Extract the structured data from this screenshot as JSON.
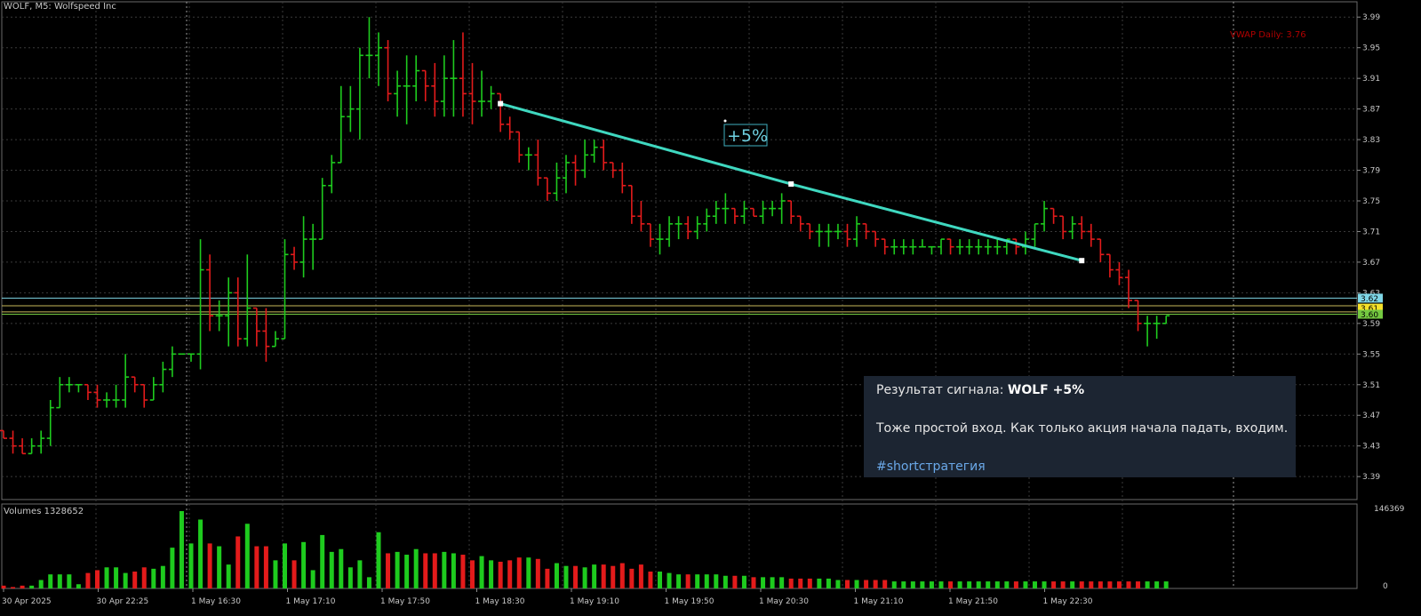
{
  "chart_title": "WOLF, M5:  Wolfspeed Inc",
  "volume_title": "Volumes 1328652",
  "vwap_label": "VWAP Daily: 3.76",
  "volume_axis": {
    "max_label": "146369",
    "zero_label": "0"
  },
  "annotation_label": "+5%",
  "colors": {
    "up": "#1ecb1e",
    "down": "#e31b1b",
    "grid": "#3a3a3a",
    "trend": "#3fd8c0",
    "level_cyan": "#7fd6e6",
    "level_yellow": "#f5e12a",
    "level_olive": "#c8b85a",
    "level_green": "#74c840"
  },
  "message": {
    "prefix": "Результат сигнала: ",
    "highlight": "WOLF +5%",
    "body": "Тоже простой вход. Как только акция начала падать, входим.",
    "hashtag": "#shortстратегия"
  },
  "chart_data": {
    "type": "candlestick",
    "y_ticks": [
      "3.99",
      "3.95",
      "3.91",
      "3.87",
      "3.83",
      "3.79",
      "3.75",
      "3.71",
      "3.67",
      "3.63",
      "3.59",
      "3.55",
      "3.51",
      "3.47",
      "3.43",
      "3.39"
    ],
    "ylim": [
      3.36,
      4.01
    ],
    "price_labels": [
      {
        "text": "3.62",
        "value": 3.623,
        "color": "#7fd6e6"
      },
      {
        "text": "3.61",
        "value": 3.61,
        "color": "#f5e12a"
      },
      {
        "text": "3.60",
        "value": 3.602,
        "color": "#74c840"
      }
    ],
    "x_labels": [
      "30 Apr 2025",
      "30 Apr 22:25",
      "1 May 16:30",
      "1 May 17:10",
      "1 May 17:50",
      "1 May 18:30",
      "1 May 19:10",
      "1 May 19:50",
      "1 May 20:30",
      "1 May 21:10",
      "1 May 21:50",
      "1 May 22:30"
    ],
    "candles": [
      [
        3.45,
        3.45,
        3.44,
        3.44
      ],
      [
        3.44,
        3.45,
        3.42,
        3.43
      ],
      [
        3.43,
        3.44,
        3.42,
        3.42
      ],
      [
        3.42,
        3.44,
        3.42,
        3.43
      ],
      [
        3.43,
        3.45,
        3.42,
        3.44
      ],
      [
        3.44,
        3.49,
        3.43,
        3.48
      ],
      [
        3.48,
        3.52,
        3.48,
        3.51
      ],
      [
        3.51,
        3.52,
        3.5,
        3.51
      ],
      [
        3.51,
        3.51,
        3.5,
        3.51
      ],
      [
        3.51,
        3.51,
        3.49,
        3.5
      ],
      [
        3.5,
        3.51,
        3.48,
        3.49
      ],
      [
        3.49,
        3.5,
        3.48,
        3.49
      ],
      [
        3.49,
        3.51,
        3.48,
        3.49
      ],
      [
        3.49,
        3.55,
        3.48,
        3.52
      ],
      [
        3.52,
        3.52,
        3.5,
        3.51
      ],
      [
        3.51,
        3.51,
        3.48,
        3.49
      ],
      [
        3.49,
        3.52,
        3.49,
        3.51
      ],
      [
        3.51,
        3.54,
        3.5,
        3.53
      ],
      [
        3.53,
        3.56,
        3.52,
        3.55
      ],
      [
        3.55,
        3.55,
        3.55,
        3.55
      ],
      [
        3.55,
        3.55,
        3.54,
        3.55
      ],
      [
        3.55,
        3.7,
        3.53,
        3.66
      ],
      [
        3.66,
        3.68,
        3.58,
        3.6
      ],
      [
        3.6,
        3.62,
        3.58,
        3.6
      ],
      [
        3.6,
        3.65,
        3.56,
        3.63
      ],
      [
        3.63,
        3.65,
        3.56,
        3.57
      ],
      [
        3.57,
        3.68,
        3.56,
        3.61
      ],
      [
        3.61,
        3.61,
        3.56,
        3.58
      ],
      [
        3.58,
        3.61,
        3.54,
        3.56
      ],
      [
        3.56,
        3.58,
        3.56,
        3.57
      ],
      [
        3.57,
        3.7,
        3.57,
        3.68
      ],
      [
        3.68,
        3.69,
        3.66,
        3.67
      ],
      [
        3.67,
        3.73,
        3.65,
        3.7
      ],
      [
        3.7,
        3.72,
        3.66,
        3.7
      ],
      [
        3.7,
        3.78,
        3.7,
        3.77
      ],
      [
        3.77,
        3.81,
        3.76,
        3.8
      ],
      [
        3.8,
        3.9,
        3.8,
        3.86
      ],
      [
        3.86,
        3.9,
        3.84,
        3.87
      ],
      [
        3.87,
        3.95,
        3.83,
        3.94
      ],
      [
        3.94,
        3.99,
        3.91,
        3.94
      ],
      [
        3.94,
        3.97,
        3.9,
        3.95
      ],
      [
        3.95,
        3.96,
        3.88,
        3.89
      ],
      [
        3.89,
        3.92,
        3.86,
        3.9
      ],
      [
        3.9,
        3.94,
        3.85,
        3.9
      ],
      [
        3.9,
        3.94,
        3.88,
        3.92
      ],
      [
        3.92,
        3.92,
        3.88,
        3.9
      ],
      [
        3.9,
        3.93,
        3.86,
        3.88
      ],
      [
        3.88,
        3.94,
        3.86,
        3.91
      ],
      [
        3.91,
        3.96,
        3.86,
        3.91
      ],
      [
        3.91,
        3.97,
        3.86,
        3.89
      ],
      [
        3.89,
        3.93,
        3.85,
        3.88
      ],
      [
        3.88,
        3.92,
        3.86,
        3.88
      ],
      [
        3.88,
        3.9,
        3.87,
        3.89
      ],
      [
        3.89,
        3.89,
        3.84,
        3.85
      ],
      [
        3.85,
        3.86,
        3.83,
        3.84
      ],
      [
        3.84,
        3.84,
        3.8,
        3.81
      ],
      [
        3.81,
        3.82,
        3.79,
        3.81
      ],
      [
        3.81,
        3.83,
        3.77,
        3.78
      ],
      [
        3.78,
        3.78,
        3.75,
        3.76
      ],
      [
        3.76,
        3.8,
        3.75,
        3.78
      ],
      [
        3.78,
        3.81,
        3.76,
        3.8
      ],
      [
        3.8,
        3.81,
        3.77,
        3.79
      ],
      [
        3.79,
        3.83,
        3.78,
        3.81
      ],
      [
        3.81,
        3.83,
        3.8,
        3.82
      ],
      [
        3.82,
        3.83,
        3.79,
        3.8
      ],
      [
        3.8,
        3.8,
        3.78,
        3.79
      ],
      [
        3.79,
        3.8,
        3.76,
        3.77
      ],
      [
        3.77,
        3.77,
        3.72,
        3.73
      ],
      [
        3.73,
        3.75,
        3.71,
        3.72
      ],
      [
        3.72,
        3.72,
        3.69,
        3.7
      ],
      [
        3.7,
        3.72,
        3.68,
        3.7
      ],
      [
        3.7,
        3.73,
        3.69,
        3.72
      ],
      [
        3.72,
        3.73,
        3.7,
        3.72
      ],
      [
        3.72,
        3.73,
        3.7,
        3.71
      ],
      [
        3.71,
        3.73,
        3.7,
        3.72
      ],
      [
        3.72,
        3.74,
        3.71,
        3.73
      ],
      [
        3.73,
        3.75,
        3.72,
        3.74
      ],
      [
        3.74,
        3.76,
        3.72,
        3.74
      ],
      [
        3.74,
        3.74,
        3.72,
        3.73
      ],
      [
        3.73,
        3.75,
        3.72,
        3.74
      ],
      [
        3.74,
        3.74,
        3.73,
        3.73
      ],
      [
        3.73,
        3.75,
        3.72,
        3.74
      ],
      [
        3.74,
        3.75,
        3.73,
        3.74
      ],
      [
        3.74,
        3.76,
        3.72,
        3.75
      ],
      [
        3.75,
        3.75,
        3.72,
        3.73
      ],
      [
        3.73,
        3.73,
        3.71,
        3.72
      ],
      [
        3.72,
        3.72,
        3.7,
        3.71
      ],
      [
        3.71,
        3.72,
        3.69,
        3.71
      ],
      [
        3.71,
        3.72,
        3.69,
        3.71
      ],
      [
        3.71,
        3.72,
        3.7,
        3.71
      ],
      [
        3.71,
        3.72,
        3.69,
        3.7
      ],
      [
        3.7,
        3.73,
        3.69,
        3.72
      ],
      [
        3.72,
        3.72,
        3.7,
        3.71
      ],
      [
        3.71,
        3.71,
        3.69,
        3.7
      ],
      [
        3.7,
        3.7,
        3.68,
        3.69
      ],
      [
        3.69,
        3.7,
        3.68,
        3.69
      ],
      [
        3.69,
        3.7,
        3.68,
        3.69
      ],
      [
        3.69,
        3.7,
        3.68,
        3.69
      ],
      [
        3.69,
        3.7,
        3.69,
        3.69
      ],
      [
        3.69,
        3.69,
        3.68,
        3.69
      ],
      [
        3.69,
        3.7,
        3.68,
        3.7
      ],
      [
        3.7,
        3.7,
        3.68,
        3.69
      ],
      [
        3.69,
        3.7,
        3.68,
        3.69
      ],
      [
        3.69,
        3.7,
        3.68,
        3.69
      ],
      [
        3.69,
        3.7,
        3.68,
        3.69
      ],
      [
        3.69,
        3.7,
        3.68,
        3.69
      ],
      [
        3.69,
        3.7,
        3.68,
        3.69
      ],
      [
        3.69,
        3.7,
        3.68,
        3.7
      ],
      [
        3.7,
        3.7,
        3.68,
        3.69
      ],
      [
        3.69,
        3.71,
        3.68,
        3.7
      ],
      [
        3.7,
        3.72,
        3.69,
        3.72
      ],
      [
        3.72,
        3.75,
        3.71,
        3.74
      ],
      [
        3.74,
        3.74,
        3.72,
        3.73
      ],
      [
        3.73,
        3.73,
        3.7,
        3.71
      ],
      [
        3.71,
        3.73,
        3.7,
        3.72
      ],
      [
        3.72,
        3.73,
        3.7,
        3.71
      ],
      [
        3.71,
        3.72,
        3.69,
        3.7
      ],
      [
        3.7,
        3.7,
        3.67,
        3.68
      ],
      [
        3.68,
        3.68,
        3.65,
        3.66
      ],
      [
        3.66,
        3.67,
        3.64,
        3.65
      ],
      [
        3.65,
        3.66,
        3.61,
        3.62
      ],
      [
        3.62,
        3.62,
        3.58,
        3.59
      ],
      [
        3.59,
        3.6,
        3.56,
        3.59
      ],
      [
        3.59,
        3.6,
        3.57,
        3.59
      ],
      [
        3.59,
        3.6,
        3.59,
        3.6
      ]
    ],
    "volumes": [
      2,
      1,
      2,
      2,
      6,
      10,
      10,
      10,
      3,
      11,
      13,
      15,
      15,
      11,
      12,
      15,
      14,
      16,
      29,
      55,
      32,
      49,
      32,
      30,
      17,
      37,
      46,
      30,
      30,
      20,
      32,
      20,
      33,
      13,
      38,
      26,
      28,
      15,
      20,
      8,
      40,
      25,
      26,
      24,
      28,
      25,
      25,
      26,
      25,
      24,
      20,
      23,
      20,
      19,
      20,
      22,
      22,
      21,
      14,
      18,
      16,
      16,
      15,
      17,
      17,
      16,
      18,
      14,
      17,
      12,
      12,
      11,
      10,
      10,
      10,
      10,
      10,
      9,
      9,
      9,
      8,
      8,
      8,
      8,
      7,
      7,
      7,
      7,
      7,
      6,
      6,
      6,
      6,
      6,
      6,
      5,
      5,
      5,
      5,
      5,
      5,
      5,
      5,
      5,
      5,
      5,
      5,
      5,
      5,
      5,
      5,
      5,
      5,
      5,
      5,
      5,
      5,
      5,
      5,
      5,
      5,
      5,
      5,
      5,
      5,
      5,
      5
    ],
    "vol_max": 146369,
    "trend_line_points": [
      {
        "candle": 53,
        "value": 3.877
      },
      {
        "candle": 84,
        "value": 3.772
      },
      {
        "candle": 115,
        "value": 3.672
      }
    ],
    "levels": [
      {
        "value": 3.623,
        "color": "#7fd6e6"
      },
      {
        "value": 3.613,
        "color": "#c8b85a"
      },
      {
        "value": 3.605,
        "color": "#c8b85a"
      },
      {
        "value": 3.602,
        "color": "#74c840"
      }
    ]
  }
}
